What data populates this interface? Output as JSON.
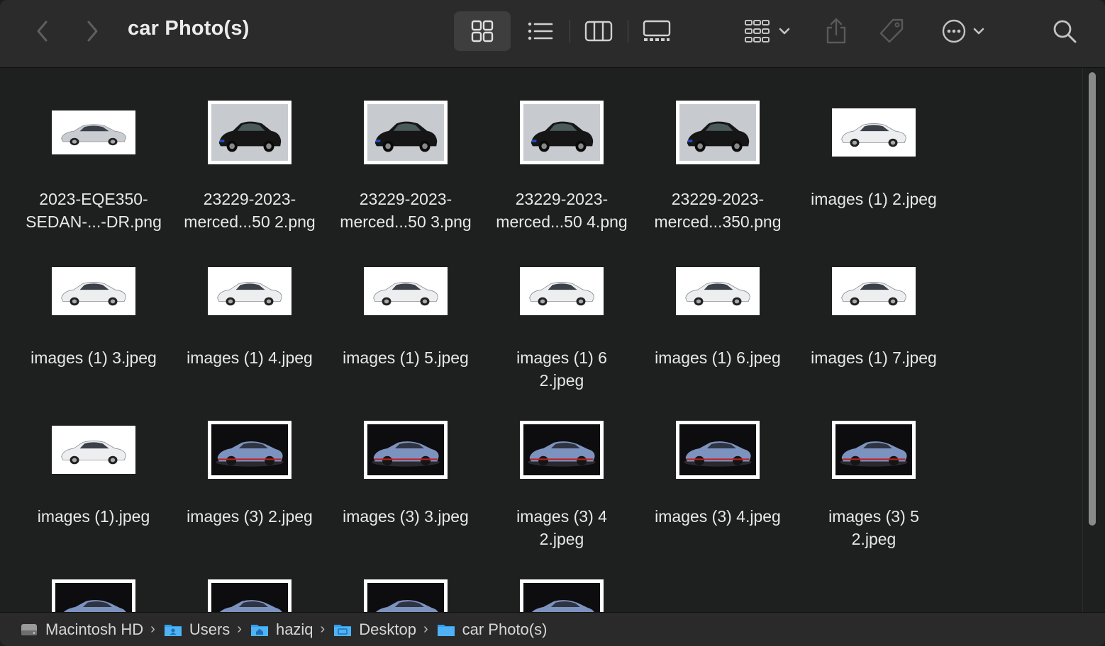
{
  "window": {
    "title": "car Photo(s)"
  },
  "toolbar": {
    "back_icon": "chevron-left-icon",
    "forward_icon": "chevron-right-icon",
    "view_icons": [
      "icon-grid-icon",
      "list-icon",
      "columns-icon",
      "gallery-icon"
    ],
    "group_icon": "group-by-icon",
    "share_icon": "share-icon",
    "tag_icon": "tag-icon",
    "more_icon": "ellipsis-circle-icon",
    "search_icon": "search-icon"
  },
  "files": [
    {
      "line1": "2023-EQE350-",
      "line2": "SEDAN-...-DR.png",
      "kind": "white-silver"
    },
    {
      "line1": "23229-2023-",
      "line2": "merced...50 2.png",
      "kind": "grey-black"
    },
    {
      "line1": "23229-2023-",
      "line2": "merced...50 3.png",
      "kind": "grey-black"
    },
    {
      "line1": "23229-2023-",
      "line2": "merced...50 4.png",
      "kind": "grey-black"
    },
    {
      "line1": "23229-2023-",
      "line2": "merced...350.png",
      "kind": "grey-black"
    },
    {
      "line1": "images (1) 2.jpeg",
      "line2": "",
      "kind": "white-white"
    },
    {
      "line1": "images (1) 3.jpeg",
      "line2": "",
      "kind": "white-white"
    },
    {
      "line1": "images (1) 4.jpeg",
      "line2": "",
      "kind": "white-white"
    },
    {
      "line1": "images (1) 5.jpeg",
      "line2": "",
      "kind": "white-white"
    },
    {
      "line1": "images (1) 6",
      "line2": "2.jpeg",
      "kind": "white-white"
    },
    {
      "line1": "images (1) 6.jpeg",
      "line2": "",
      "kind": "white-white"
    },
    {
      "line1": "images (1) 7.jpeg",
      "line2": "",
      "kind": "white-white"
    },
    {
      "line1": "images (1).jpeg",
      "line2": "",
      "kind": "white-white"
    },
    {
      "line1": "images (3) 2.jpeg",
      "line2": "",
      "kind": "dark-blue"
    },
    {
      "line1": "images (3) 3.jpeg",
      "line2": "",
      "kind": "dark-blue"
    },
    {
      "line1": "images (3) 4",
      "line2": "2.jpeg",
      "kind": "dark-blue"
    },
    {
      "line1": "images (3) 4.jpeg",
      "line2": "",
      "kind": "dark-blue"
    },
    {
      "line1": "images (3) 5",
      "line2": "2.jpeg",
      "kind": "dark-blue"
    },
    {
      "line1": "",
      "line2": "",
      "kind": "dark-blue"
    },
    {
      "line1": "",
      "line2": "",
      "kind": "dark-blue"
    },
    {
      "line1": "",
      "line2": "",
      "kind": "dark-blue"
    },
    {
      "line1": "",
      "line2": "",
      "kind": "dark-blue"
    }
  ],
  "pathbar": {
    "items": [
      {
        "label": "Macintosh HD",
        "icon": "hard-drive-icon"
      },
      {
        "label": "Users",
        "icon": "folder-users-icon"
      },
      {
        "label": "haziq",
        "icon": "home-folder-icon"
      },
      {
        "label": "Desktop",
        "icon": "desktop-folder-icon"
      },
      {
        "label": "car Photo(s)",
        "icon": "folder-icon"
      }
    ]
  },
  "colors": {
    "folder_blue": "#2f9ff0",
    "toolbar_bg": "#2b2b2b",
    "content_bg": "#1e1f1f"
  }
}
